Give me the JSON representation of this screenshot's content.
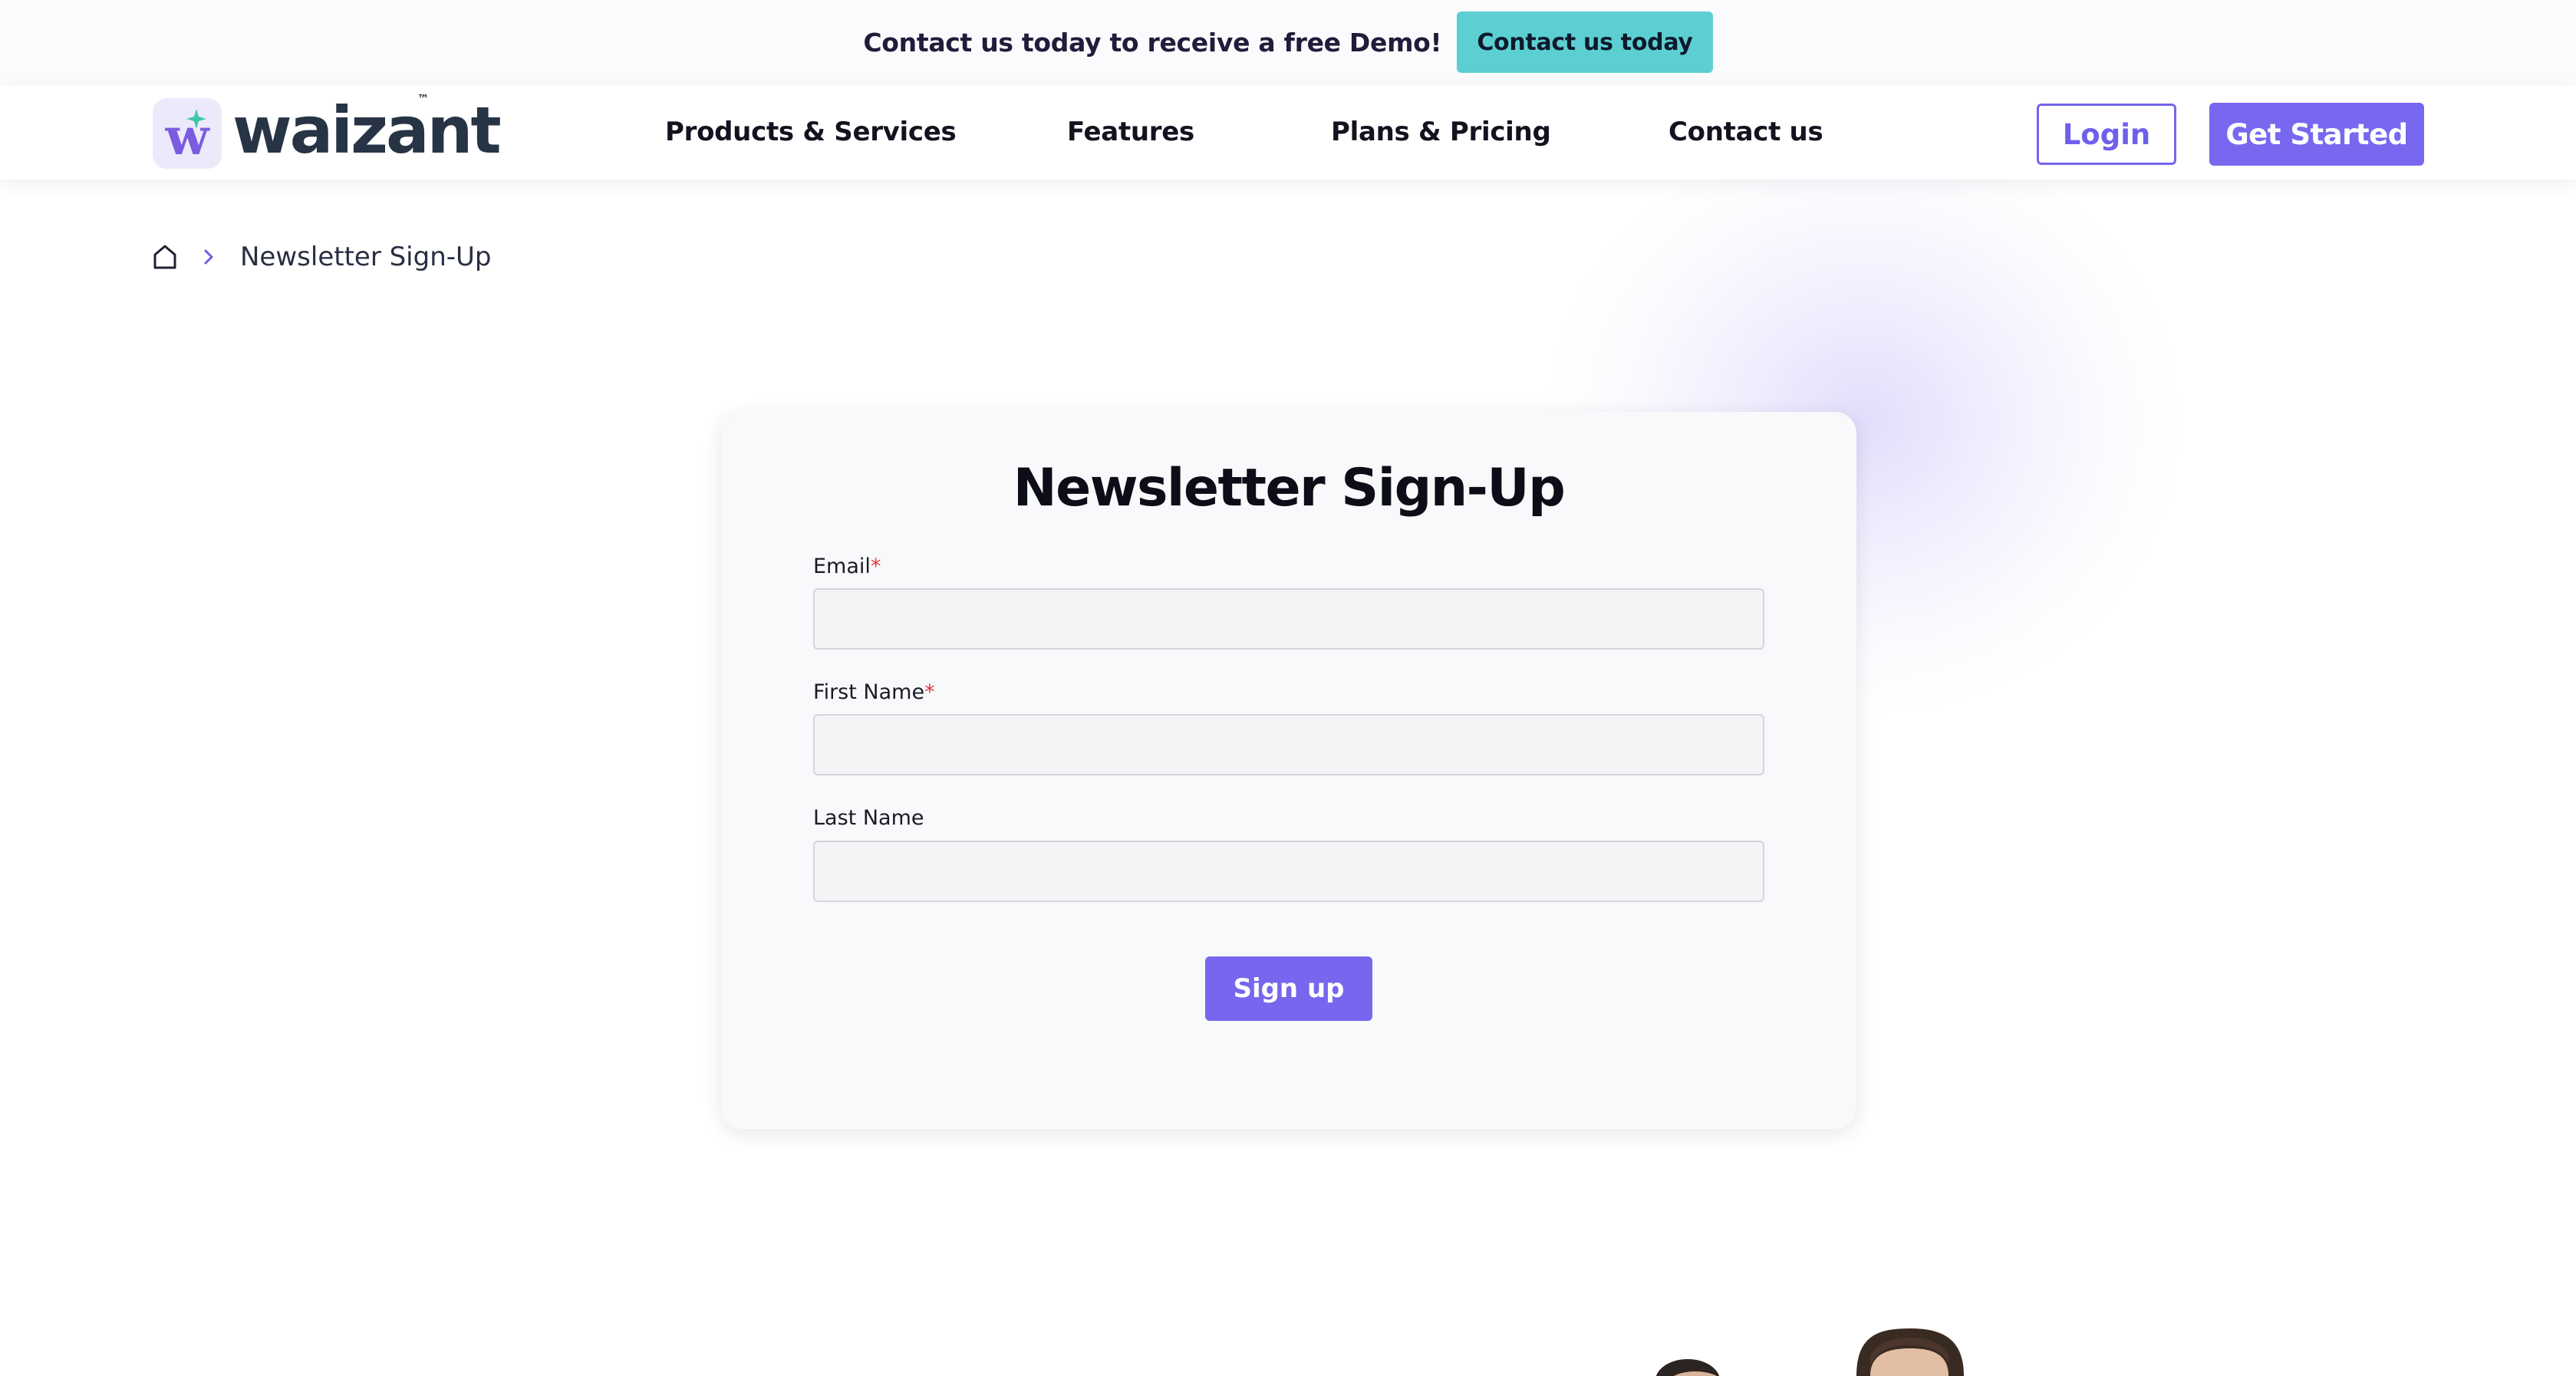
{
  "promo": {
    "text": "Contact us today to receive a free Demo!",
    "button_label": "Contact us today",
    "button_color": "#5ccfd3"
  },
  "header": {
    "logo_text": "waizant",
    "logo_tm": "™",
    "nav": [
      {
        "label": "Products & Services"
      },
      {
        "label": "Features"
      },
      {
        "label": "Plans & Pricing"
      },
      {
        "label": "Contact us"
      }
    ],
    "login_label": "Login",
    "get_started_label": "Get Started",
    "accent_color": "#7868ef"
  },
  "breadcrumb": {
    "home_icon": "home-icon",
    "separator_icon": "chevron-right-icon",
    "current": "Newsletter Sign-Up"
  },
  "form": {
    "title": "Newsletter Sign-Up",
    "fields": [
      {
        "label": "Email",
        "required_mark": "*",
        "value": "",
        "placeholder": ""
      },
      {
        "label": "First Name",
        "required_mark": "*",
        "value": "",
        "placeholder": ""
      },
      {
        "label": "Last Name",
        "value": "",
        "placeholder": ""
      }
    ],
    "submit_label": "Sign up"
  }
}
